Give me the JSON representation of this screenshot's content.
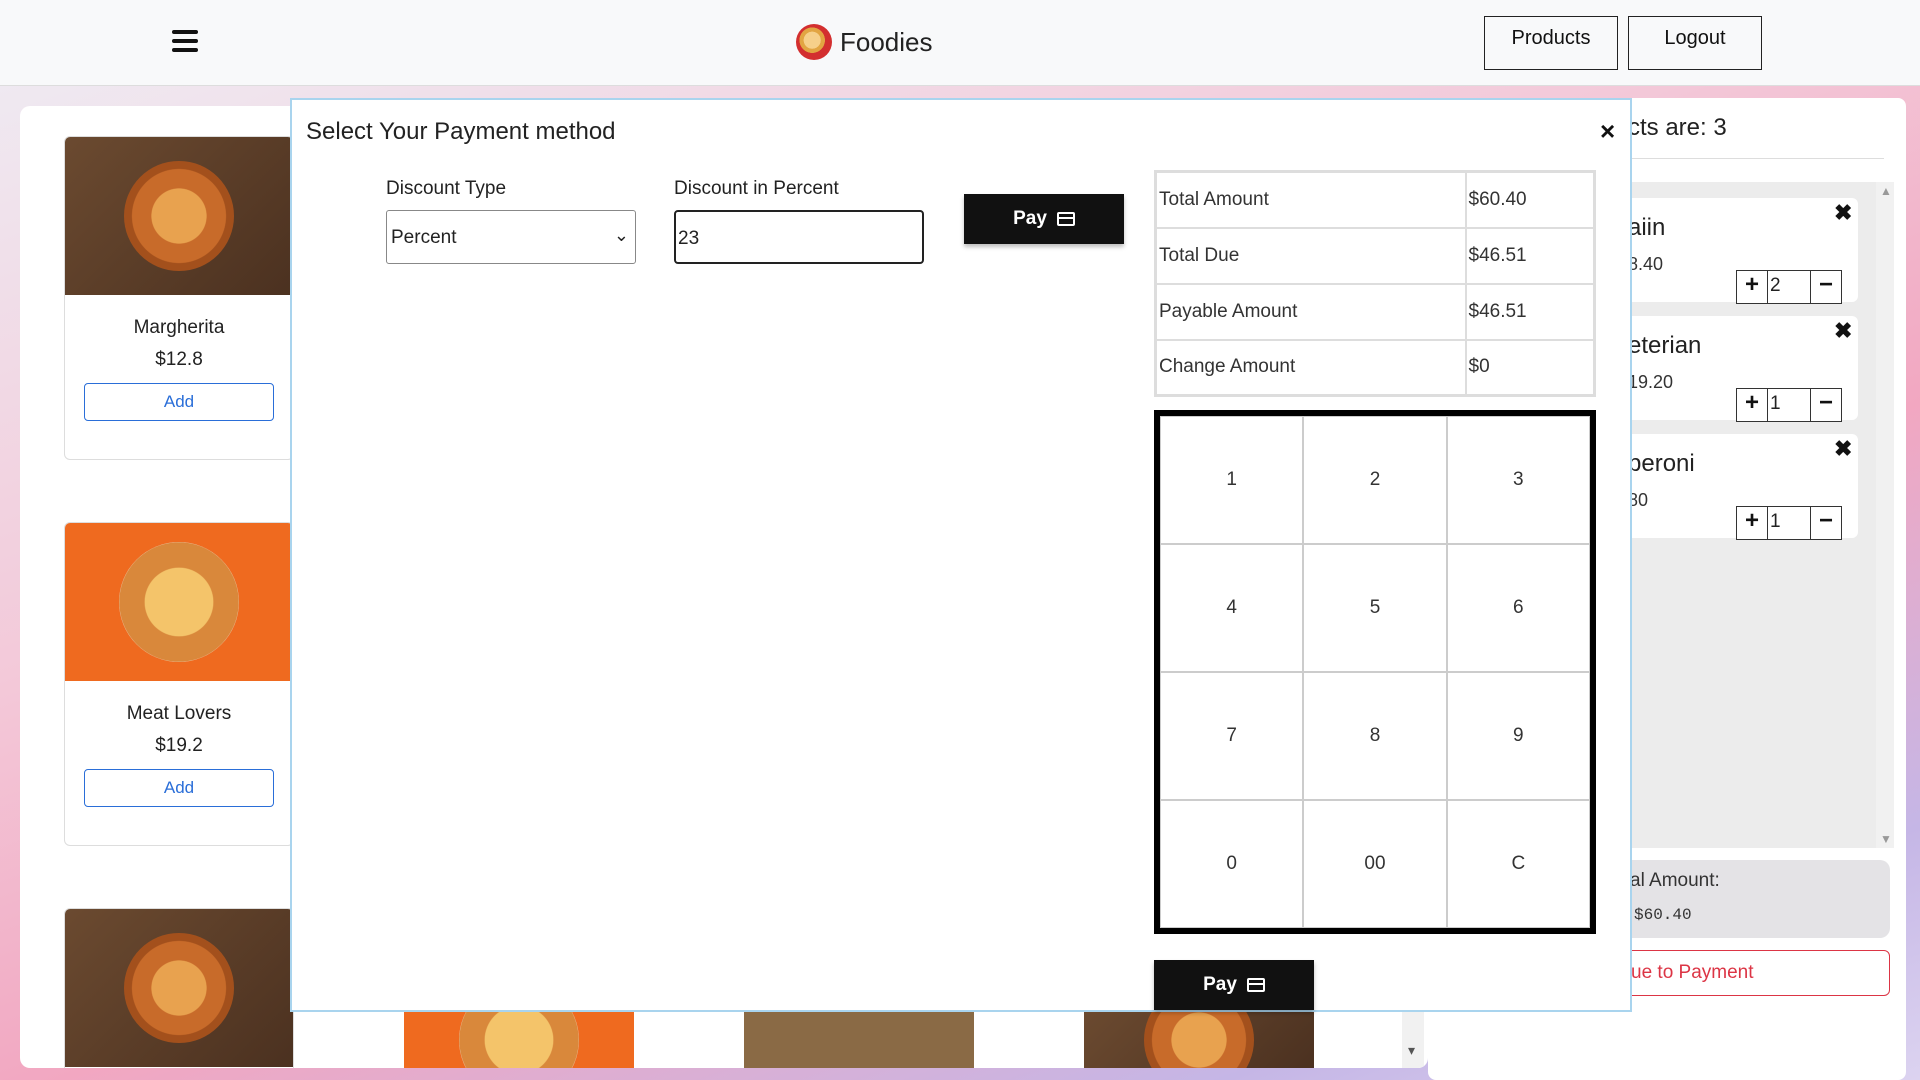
{
  "header": {
    "brand": "Foodies",
    "products_label": "Products",
    "logout_label": "Logout"
  },
  "products": [
    {
      "name": "Margherita",
      "price": "$12.8",
      "add_label": "Add"
    },
    {
      "name": "Meat Lovers",
      "price": "$19.2",
      "add_label": "Add"
    }
  ],
  "cart": {
    "title": "cts are: 3",
    "items": [
      {
        "name": "aiin",
        "price": "8.40",
        "qty": "2"
      },
      {
        "name": "eterian",
        "price": "19.20",
        "qty": "1"
      },
      {
        "name": "peroni",
        "price": "80",
        "qty": "1"
      }
    ],
    "total_label": "al Amount:",
    "total_value": "$60.40",
    "continue_label": "ue to Payment"
  },
  "modal": {
    "title": "Select Your Payment method",
    "discount_type_label": "Discount Type",
    "discount_type_value": "Percent",
    "discount_percent_label": "Discount in Percent",
    "discount_percent_value": "23",
    "pay_label": "Pay",
    "summary": [
      {
        "label": "Total Amount",
        "value": "$60.40"
      },
      {
        "label": "Total Due",
        "value": "$46.51"
      },
      {
        "label": "Payable Amount",
        "value": "$46.51"
      },
      {
        "label": "Change Amount",
        "value": "$0"
      }
    ],
    "keypad": [
      "1",
      "2",
      "3",
      "4",
      "5",
      "6",
      "7",
      "8",
      "9",
      "0",
      "00",
      "C"
    ]
  },
  "icons": {
    "menu": "hamburger-menu-icon",
    "close": "close-icon",
    "card": "credit-card-icon",
    "plus": "plus-icon",
    "minus": "minus-icon"
  },
  "colors": {
    "accent_blue": "#2a6ed8",
    "danger_red": "#dc3545",
    "modal_border": "#a9d4ee",
    "pay_button": "#111111"
  }
}
